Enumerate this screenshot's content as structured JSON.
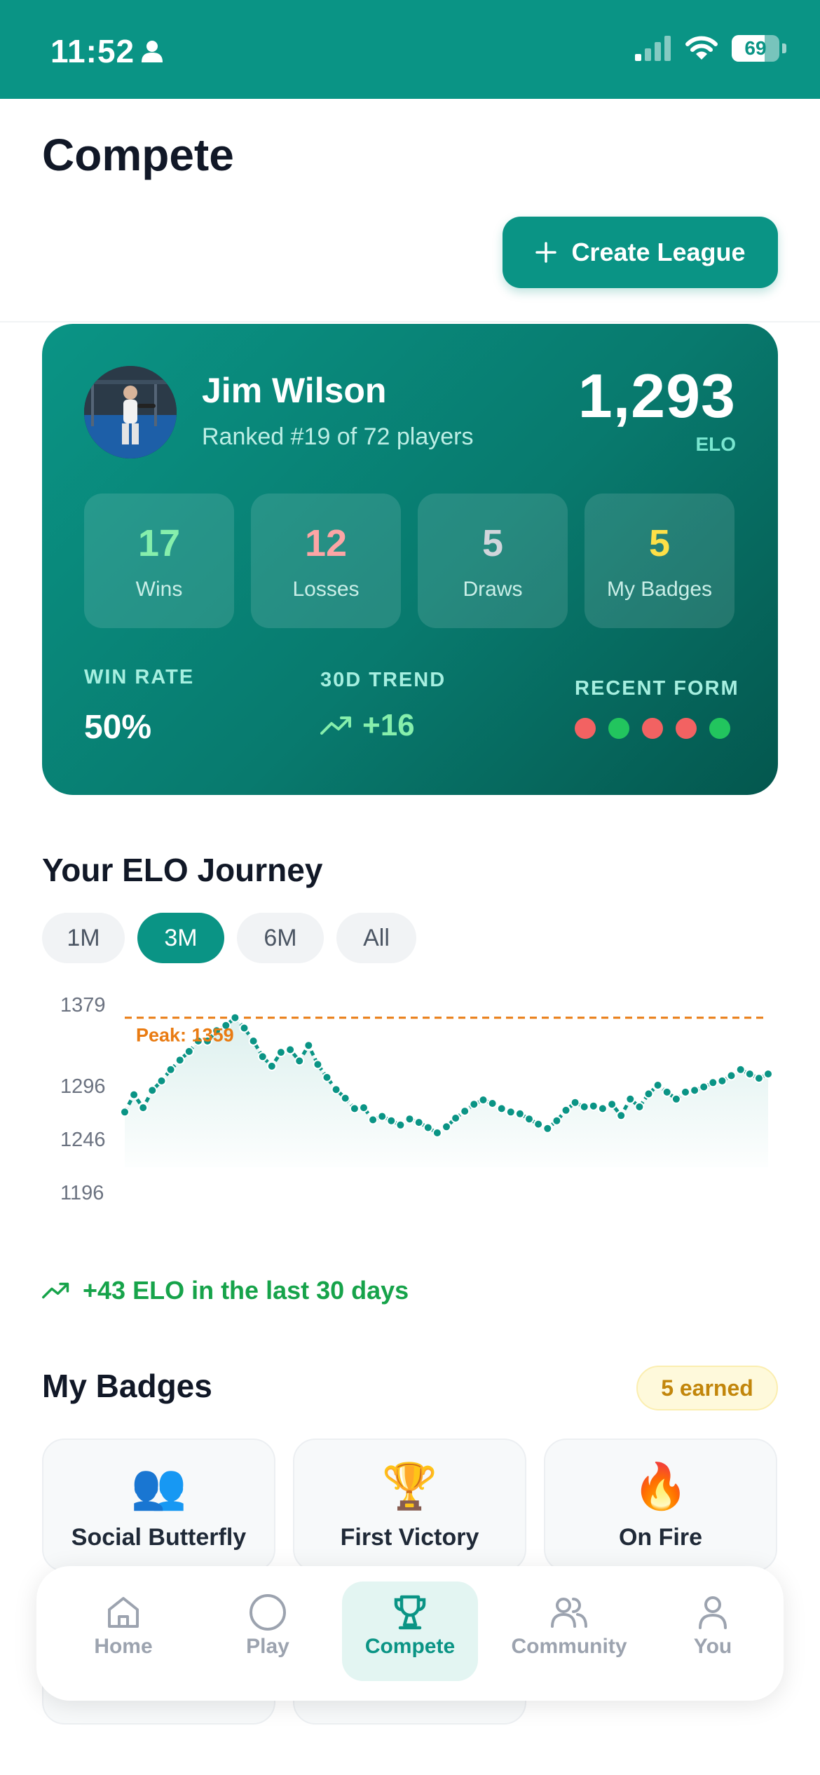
{
  "status_bar": {
    "time": "11:52",
    "battery": "69",
    "battery_level": 0.69
  },
  "header": {
    "title": "Compete",
    "create_label": "Create League"
  },
  "profile": {
    "name": "Jim Wilson",
    "rank_text": "Ranked #19 of 72 players",
    "elo": "1,293",
    "elo_label": "ELO"
  },
  "stats": [
    {
      "value": "17",
      "label": "Wins",
      "color": "#86efac"
    },
    {
      "value": "12",
      "label": "Losses",
      "color": "#fca5a5"
    },
    {
      "value": "5",
      "label": "Draws",
      "color": "#d1d5db"
    },
    {
      "value": "5",
      "label": "My Badges",
      "color": "#fde047"
    }
  ],
  "metrics": {
    "win_rate_label": "WIN RATE",
    "win_rate_value": "50%",
    "trend_label": "30D TREND",
    "trend_value": "+16",
    "form_label": "RECENT FORM",
    "form": [
      "loss",
      "win",
      "loss",
      "loss",
      "win"
    ],
    "form_colors": {
      "win": "#22c55e",
      "loss": "#f26262"
    }
  },
  "elo_journey": {
    "title": "Your ELO Journey",
    "ranges": [
      "1M",
      "3M",
      "6M",
      "All"
    ],
    "active_range": "3M",
    "trend_note": "+43 ELO in the last 30 days"
  },
  "chart_data": {
    "type": "line",
    "title": "",
    "ylim": [
      1196,
      1379
    ],
    "yticks": [
      "1379",
      "1296",
      "1246",
      "1196"
    ],
    "peak_label": "Peak: 1359",
    "peak_value": 1359,
    "series": [
      {
        "values": [
          1250,
          1270,
          1255,
          1275,
          1286,
          1299,
          1310,
          1320,
          1332,
          1332,
          1344,
          1350,
          1359,
          1347,
          1332,
          1314,
          1303,
          1319,
          1322,
          1309,
          1327,
          1305,
          1290,
          1276,
          1266,
          1254,
          1255,
          1241,
          1245,
          1240,
          1235,
          1242,
          1238,
          1232,
          1226,
          1233,
          1243,
          1251,
          1259,
          1264,
          1260,
          1254,
          1250,
          1248,
          1242,
          1236,
          1231,
          1240,
          1252,
          1261,
          1256,
          1257,
          1254,
          1259,
          1246,
          1265,
          1256,
          1271,
          1281,
          1273,
          1265,
          1273,
          1275,
          1279,
          1284,
          1286,
          1292,
          1299,
          1294,
          1289,
          1294
        ]
      }
    ],
    "colors": {
      "line": "#0a9485",
      "peak": "#e97b12"
    }
  },
  "badges": {
    "title": "My Badges",
    "earned_label": "5 earned",
    "items": [
      {
        "emoji": "👥",
        "name": "Social Butterfly"
      },
      {
        "emoji": "🏆",
        "name": "First Victory"
      },
      {
        "emoji": "🔥",
        "name": "On Fire"
      }
    ]
  },
  "nav": {
    "items": [
      {
        "label": "Home",
        "icon": "home-icon"
      },
      {
        "label": "Play",
        "icon": "circle-icon"
      },
      {
        "label": "Compete",
        "icon": "trophy-icon",
        "active": true
      },
      {
        "label": "Community",
        "icon": "users-icon"
      },
      {
        "label": "You",
        "icon": "user-icon"
      }
    ]
  },
  "colors": {
    "brand": "#0a9485",
    "positive": "#16a34a"
  }
}
